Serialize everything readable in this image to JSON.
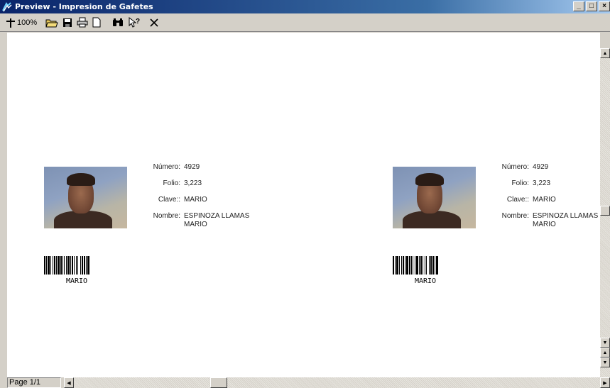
{
  "window": {
    "title": "Preview - Impresion de Gafetes",
    "buttons": {
      "minimize": "_",
      "maximize": "□",
      "close": "×"
    }
  },
  "toolbar": {
    "zoom_label": "100%",
    "icons": [
      "zoom-pin-icon",
      "open-folder-icon",
      "save-icon",
      "print-icon",
      "new-page-icon",
      "find-binoculars-icon",
      "help-pointer-icon",
      "close-x-icon"
    ]
  },
  "labels": {
    "numero": "Número:",
    "folio": "Folio:",
    "clave": "Clave::",
    "nombre": "Nombre:"
  },
  "badges": [
    {
      "numero": "4929",
      "folio": "3,223",
      "clave": "MARIO",
      "nombre_line1": "ESPINOZA LLAMAS",
      "nombre_line2": "MARIO",
      "barcode_text": "MARIO"
    },
    {
      "numero": "4929",
      "folio": "3,223",
      "clave": "MARIO",
      "nombre_line1": "ESPINOZA LLAMAS",
      "nombre_line2": "MARIO",
      "barcode_text": "MARIO"
    }
  ],
  "status": {
    "page_indicator": "Page 1/1"
  },
  "colors": {
    "titlebar_start": "#0a246a",
    "titlebar_end": "#a6caf0",
    "window_face": "#d4d0c8",
    "page_background": "#ffffff"
  }
}
